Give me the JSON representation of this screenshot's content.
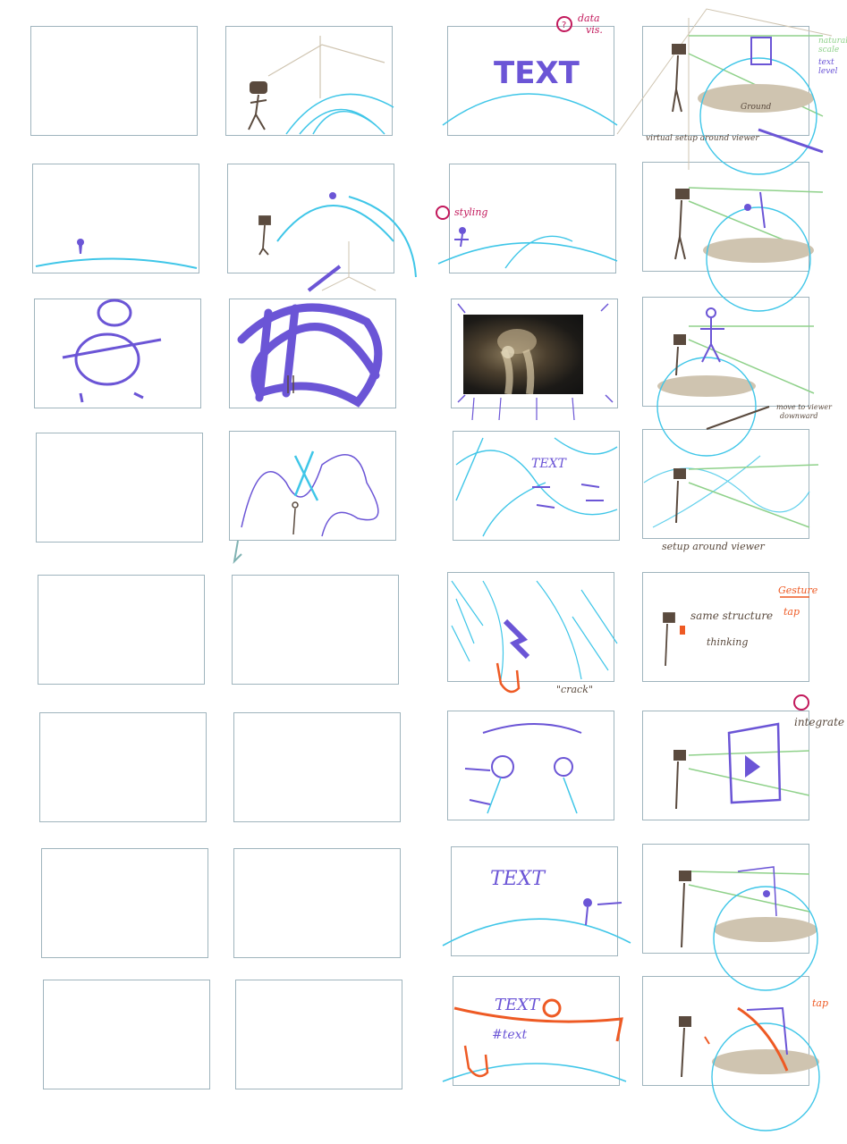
{
  "annotations": {
    "data_vis": [
      "data",
      "vis."
    ],
    "natural_scale": [
      "natural",
      "scale"
    ],
    "text_level": [
      "text",
      "level"
    ],
    "ground": "Ground",
    "virtual_setup": "virtual setup around viewer",
    "styling": "styling",
    "move_to_viewer": [
      "move to viewer",
      "downward"
    ],
    "text_1": "TEXT",
    "text_2": "TEXT",
    "text_3": "TEXT",
    "text_4": "TEXT",
    "hashtext": "#text",
    "crack": "\"crack\"",
    "setup_around_viewer": "setup around viewer",
    "same_structure": "same structure",
    "thinking": "thinking",
    "gesture": "Gesture",
    "tap_1": "tap",
    "tap_2": "tap",
    "integrate": "integrate"
  },
  "colors": {
    "frame_border": "#9fb4bd",
    "cyan": "#3fc6e8",
    "purple": "#6b55d6",
    "brown": "#5a4a3e",
    "green": "#8fd18a",
    "orange": "#ee5a24",
    "magenta": "#c2185b",
    "tan": "#cfc4b0"
  }
}
